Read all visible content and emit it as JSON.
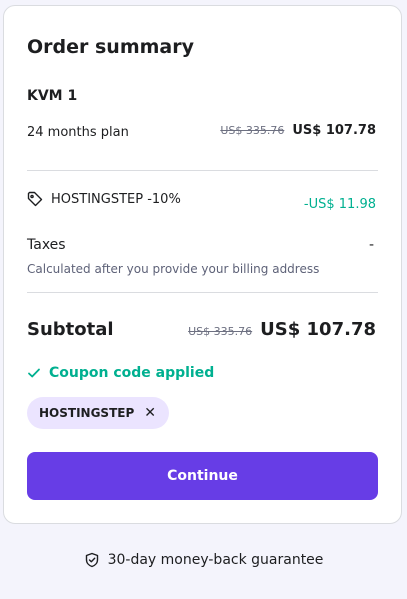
{
  "summary": {
    "title": "Order summary",
    "plan_name": "KVM 1",
    "plan_period": "24 months plan",
    "old_price": "US$ 335.76",
    "new_price": "US$ 107.78",
    "coupon_line": "HOSTINGSTEP -10%",
    "discount": "-US$ 11.98",
    "taxes_label": "Taxes",
    "taxes_value": "-",
    "taxes_note": "Calculated after you provide your billing address",
    "subtotal_label": "Subtotal",
    "subtotal_old": "US$ 335.76",
    "subtotal_new": "US$ 107.78",
    "coupon_applied": "Coupon code applied",
    "coupon_chip": "HOSTINGSTEP",
    "continue_label": "Continue"
  },
  "footer": {
    "guarantee": "30-day money-back guarantee"
  },
  "icons": {
    "tag": "tag-icon",
    "check": "check-icon",
    "close": "close-icon",
    "shield": "shield-check-icon"
  },
  "colors": {
    "accent": "#673de6",
    "success": "#00b090",
    "chip_bg": "#ebe4ff",
    "page_bg": "#f4f4fc"
  }
}
